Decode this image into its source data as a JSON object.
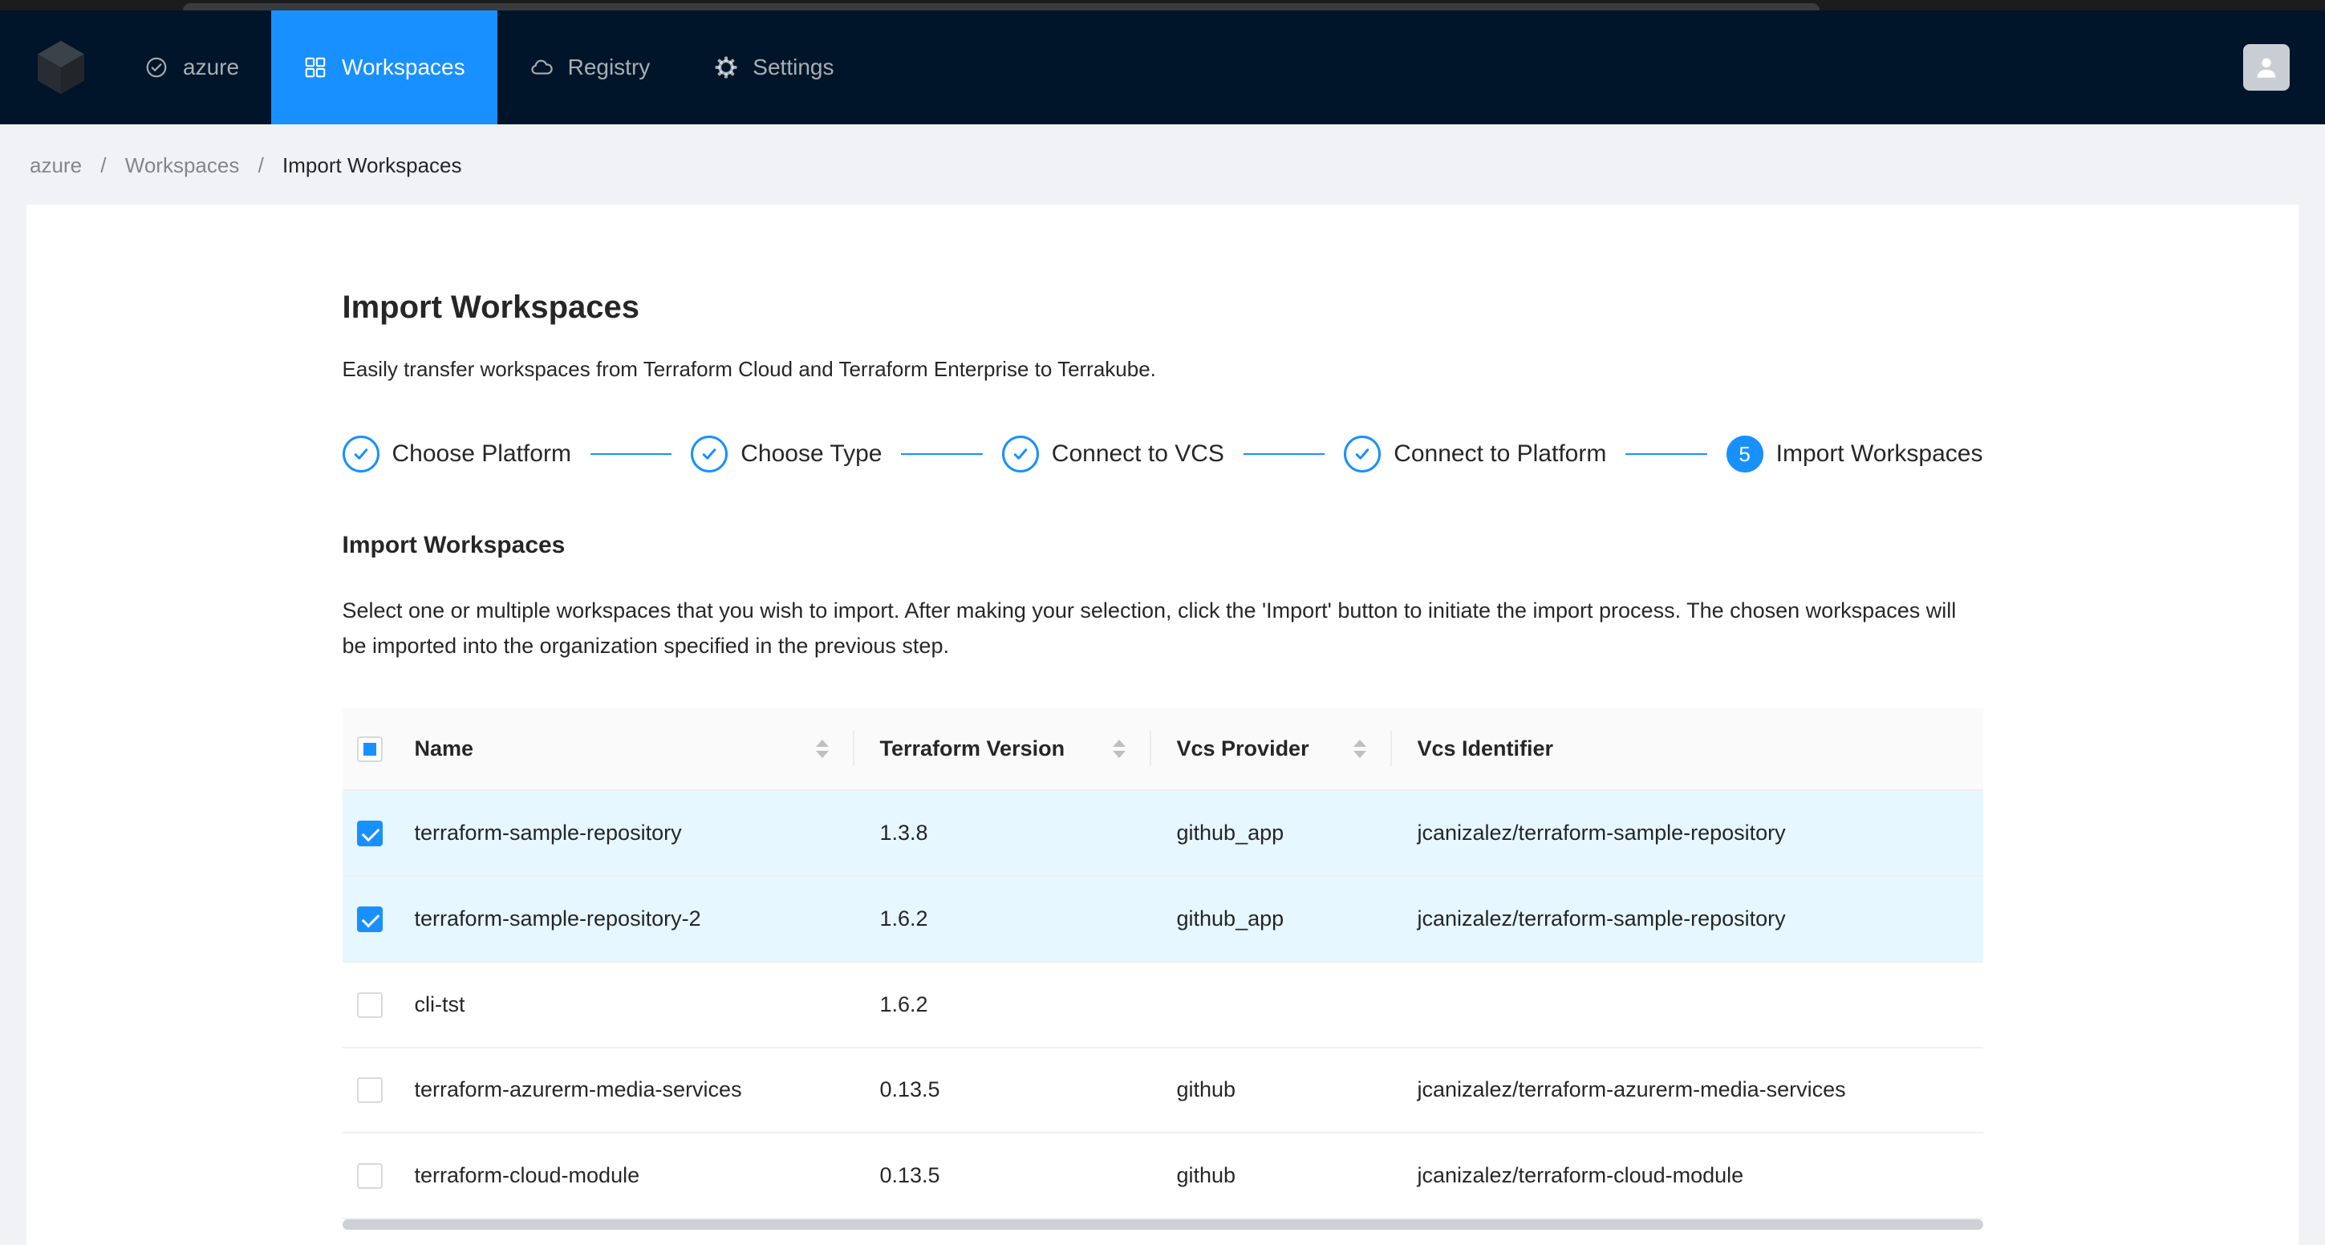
{
  "colors": {
    "accent": "#1890ff",
    "navbar_bg": "#001529",
    "selected_row_bg": "#e6f7ff",
    "page_bg": "#f0f2f5",
    "table_header_bg": "#fafafa"
  },
  "navbar": {
    "org": {
      "label": "azure",
      "icon": "check-circle-icon"
    },
    "items": [
      {
        "label": "Workspaces",
        "icon": "grid-icon",
        "active": true
      },
      {
        "label": "Registry",
        "icon": "cloud-icon",
        "active": false
      },
      {
        "label": "Settings",
        "icon": "gear-icon",
        "active": false
      }
    ],
    "avatar_icon": "user-icon"
  },
  "breadcrumb": {
    "separator": "/",
    "items": [
      "azure",
      "Workspaces",
      "Import Workspaces"
    ]
  },
  "page": {
    "title": "Import Workspaces",
    "subtitle": "Easily transfer workspaces from Terraform Cloud and Terraform Enterprise to Terrakube.",
    "steps": [
      {
        "label": "Choose Platform",
        "state": "finish"
      },
      {
        "label": "Choose Type",
        "state": "finish"
      },
      {
        "label": "Connect to VCS",
        "state": "finish"
      },
      {
        "label": "Connect to Platform",
        "state": "finish"
      },
      {
        "label": "Import Workspaces",
        "state": "current",
        "number": "5"
      }
    ],
    "section_title": "Import Workspaces",
    "section_description": "Select one or multiple workspaces that you wish to import. After making your selection, click the 'Import' button to initiate the import process. The chosen workspaces will be imported into the organization specified in the previous step.",
    "table": {
      "select_all_state": "indeterminate",
      "columns": [
        "Name",
        "Terraform Version",
        "Vcs Provider",
        "Vcs Identifier"
      ],
      "sorters": [
        true,
        true,
        true,
        false
      ],
      "rows": [
        {
          "selected": true,
          "name": "terraform-sample-repository",
          "version": "1.3.8",
          "provider": "github_app",
          "identifier": "jcanizalez/terraform-sample-repository"
        },
        {
          "selected": true,
          "name": "terraform-sample-repository-2",
          "version": "1.6.2",
          "provider": "github_app",
          "identifier": "jcanizalez/terraform-sample-repository"
        },
        {
          "selected": false,
          "name": "cli-tst",
          "version": "1.6.2",
          "provider": "",
          "identifier": ""
        },
        {
          "selected": false,
          "name": "terraform-azurerm-media-services",
          "version": "0.13.5",
          "provider": "github",
          "identifier": "jcanizalez/terraform-azurerm-media-services"
        },
        {
          "selected": false,
          "name": "terraform-cloud-module",
          "version": "0.13.5",
          "provider": "github",
          "identifier": "jcanizalez/terraform-cloud-module"
        }
      ]
    }
  }
}
